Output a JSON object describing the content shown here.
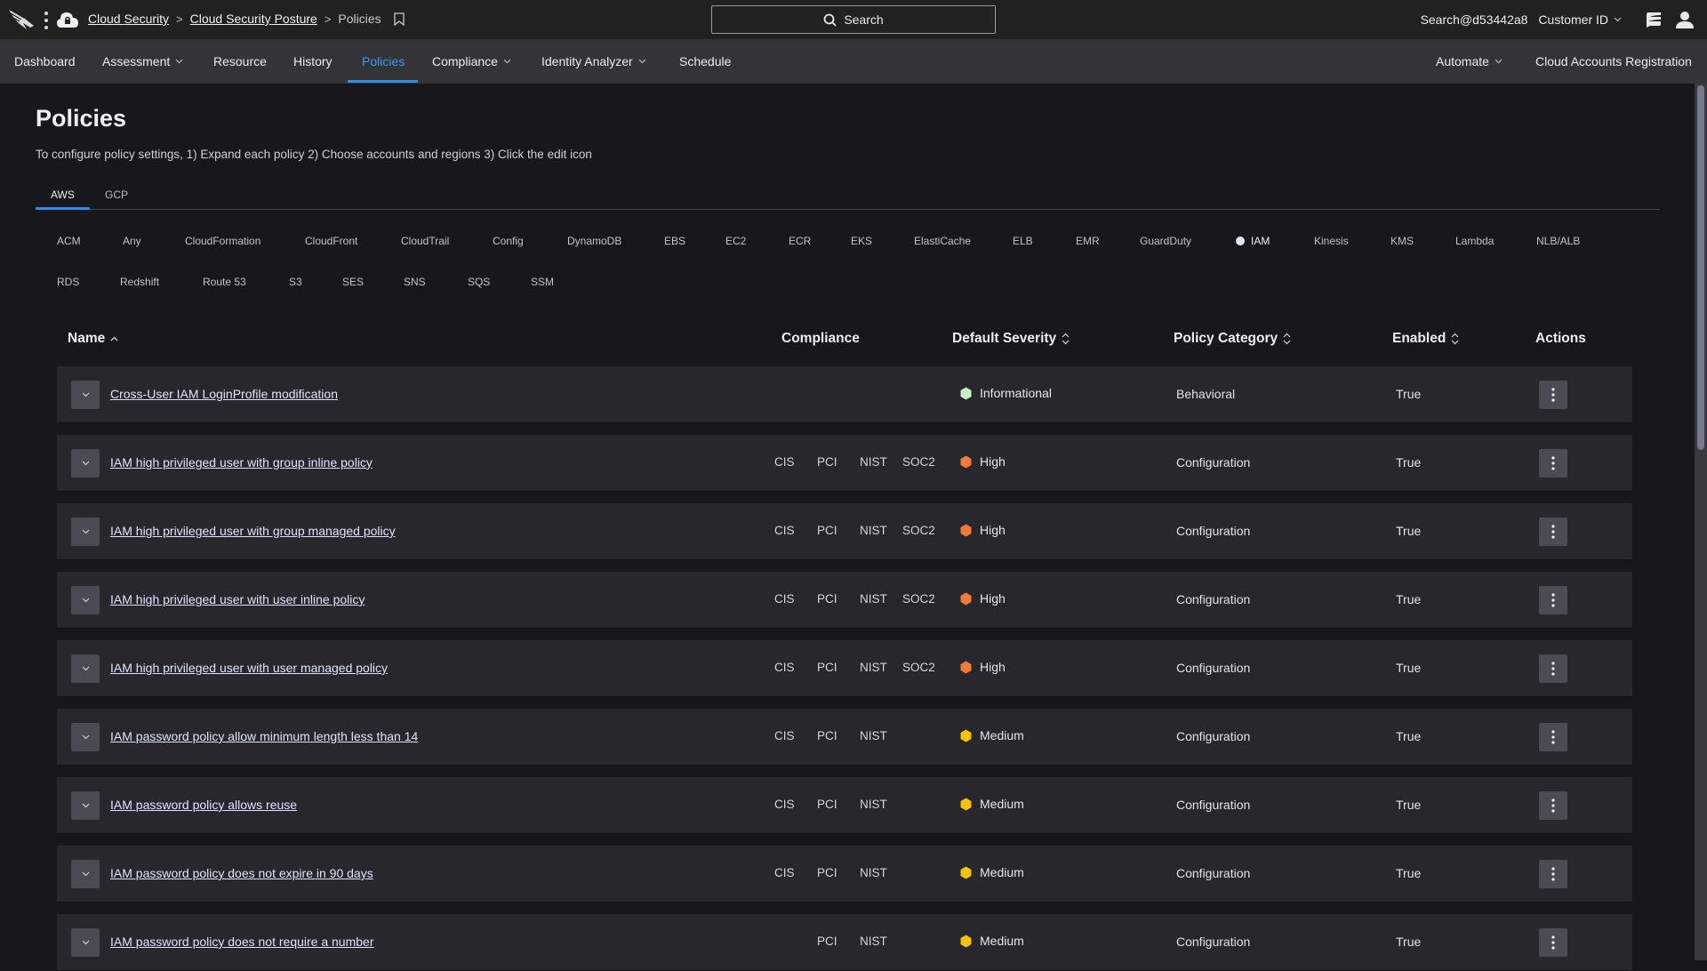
{
  "topbar": {
    "breadcrumbs": [
      {
        "label": "Cloud Security",
        "link": true
      },
      {
        "label": "Cloud Security Posture",
        "link": true
      },
      {
        "label": "Policies",
        "link": false
      }
    ],
    "search_label": "Search",
    "user": "Search@d53442a8",
    "customer_label": "Customer ID",
    "icons": [
      "crowdstrike-falcon-logo",
      "kebab-menu-icon",
      "cloud-lock-icon",
      "bookmark-icon",
      "search-icon",
      "chevron-down-icon",
      "notifications-panel-icon",
      "user-profile-icon"
    ]
  },
  "nav": {
    "items": [
      {
        "label": "Dashboard",
        "dropdown": false,
        "active": false
      },
      {
        "label": "Assessment",
        "dropdown": true,
        "active": false
      },
      {
        "label": "Resource",
        "dropdown": false,
        "active": false
      },
      {
        "label": "History",
        "dropdown": false,
        "active": false
      },
      {
        "label": "Policies",
        "dropdown": false,
        "active": true
      },
      {
        "label": "Compliance",
        "dropdown": true,
        "active": false
      },
      {
        "label": "Identity Analyzer",
        "dropdown": true,
        "active": false
      },
      {
        "label": "Schedule",
        "dropdown": false,
        "active": false
      }
    ],
    "right_items": [
      {
        "label": "Automate",
        "dropdown": true
      },
      {
        "label": "Cloud Accounts Registration",
        "dropdown": false
      }
    ],
    "accent_color": "#2f8ee8"
  },
  "page": {
    "title": "Policies",
    "instructions": "To configure policy settings, 1) Expand each policy 2) Choose accounts and regions 3) Click the edit icon",
    "cloud_tabs": [
      {
        "label": "AWS",
        "active": true
      },
      {
        "label": "GCP",
        "active": false
      }
    ],
    "services": [
      {
        "label": "ACM",
        "active": false
      },
      {
        "label": "Any",
        "active": false
      },
      {
        "label": "CloudFormation",
        "active": false
      },
      {
        "label": "CloudFront",
        "active": false
      },
      {
        "label": "CloudTrail",
        "active": false
      },
      {
        "label": "Config",
        "active": false
      },
      {
        "label": "DynamoDB",
        "active": false
      },
      {
        "label": "EBS",
        "active": false
      },
      {
        "label": "EC2",
        "active": false
      },
      {
        "label": "ECR",
        "active": false
      },
      {
        "label": "EKS",
        "active": false
      },
      {
        "label": "ElastiCache",
        "active": false
      },
      {
        "label": "ELB",
        "active": false
      },
      {
        "label": "EMR",
        "active": false
      },
      {
        "label": "GuardDuty",
        "active": false
      },
      {
        "label": "IAM",
        "active": true
      },
      {
        "label": "Kinesis",
        "active": false
      },
      {
        "label": "KMS",
        "active": false
      },
      {
        "label": "Lambda",
        "active": false
      },
      {
        "label": "NLB/ALB",
        "active": false
      },
      {
        "label": "RDS",
        "active": false
      },
      {
        "label": "Redshift",
        "active": false
      },
      {
        "label": "Route 53",
        "active": false
      },
      {
        "label": "S3",
        "active": false
      },
      {
        "label": "SES",
        "active": false
      },
      {
        "label": "SNS",
        "active": false
      },
      {
        "label": "SQS",
        "active": false
      },
      {
        "label": "SSM",
        "active": false
      }
    ]
  },
  "table": {
    "columns": {
      "name": "Name",
      "compliance": "Compliance",
      "severity": "Default Severity",
      "category": "Policy Category",
      "enabled": "Enabled",
      "actions": "Actions"
    },
    "severity_colors": {
      "Informational": "#c8f0c8",
      "High": "#f47a3a",
      "Medium": "#f5c400"
    },
    "rows": [
      {
        "name": "Cross-User IAM LoginProfile modification",
        "compliance": {
          "CIS": false,
          "PCI": false,
          "NIST": false,
          "SOC2": false
        },
        "severity": "Informational",
        "category": "Behavioral",
        "enabled": "True"
      },
      {
        "name": "IAM high privileged user with group inline policy",
        "compliance": {
          "CIS": true,
          "PCI": true,
          "NIST": true,
          "SOC2": true
        },
        "severity": "High",
        "category": "Configuration",
        "enabled": "True"
      },
      {
        "name": "IAM high privileged user with group managed policy",
        "compliance": {
          "CIS": true,
          "PCI": true,
          "NIST": true,
          "SOC2": true
        },
        "severity": "High",
        "category": "Configuration",
        "enabled": "True"
      },
      {
        "name": "IAM high privileged user with user inline policy",
        "compliance": {
          "CIS": true,
          "PCI": true,
          "NIST": true,
          "SOC2": true
        },
        "severity": "High",
        "category": "Configuration",
        "enabled": "True"
      },
      {
        "name": "IAM high privileged user with user managed policy",
        "compliance": {
          "CIS": true,
          "PCI": true,
          "NIST": true,
          "SOC2": true
        },
        "severity": "High",
        "category": "Configuration",
        "enabled": "True"
      },
      {
        "name": "IAM password policy allow minimum length less than 14",
        "compliance": {
          "CIS": true,
          "PCI": true,
          "NIST": true,
          "SOC2": false
        },
        "severity": "Medium",
        "category": "Configuration",
        "enabled": "True"
      },
      {
        "name": "IAM password policy allows reuse",
        "compliance": {
          "CIS": true,
          "PCI": true,
          "NIST": true,
          "SOC2": false
        },
        "severity": "Medium",
        "category": "Configuration",
        "enabled": "True"
      },
      {
        "name": "IAM password policy does not expire in 90 days",
        "compliance": {
          "CIS": true,
          "PCI": true,
          "NIST": true,
          "SOC2": false
        },
        "severity": "Medium",
        "category": "Configuration",
        "enabled": "True"
      },
      {
        "name": "IAM password policy does not require a number",
        "compliance": {
          "CIS": false,
          "PCI": true,
          "NIST": true,
          "SOC2": false
        },
        "severity": "Medium",
        "category": "Configuration",
        "enabled": "True"
      }
    ]
  }
}
